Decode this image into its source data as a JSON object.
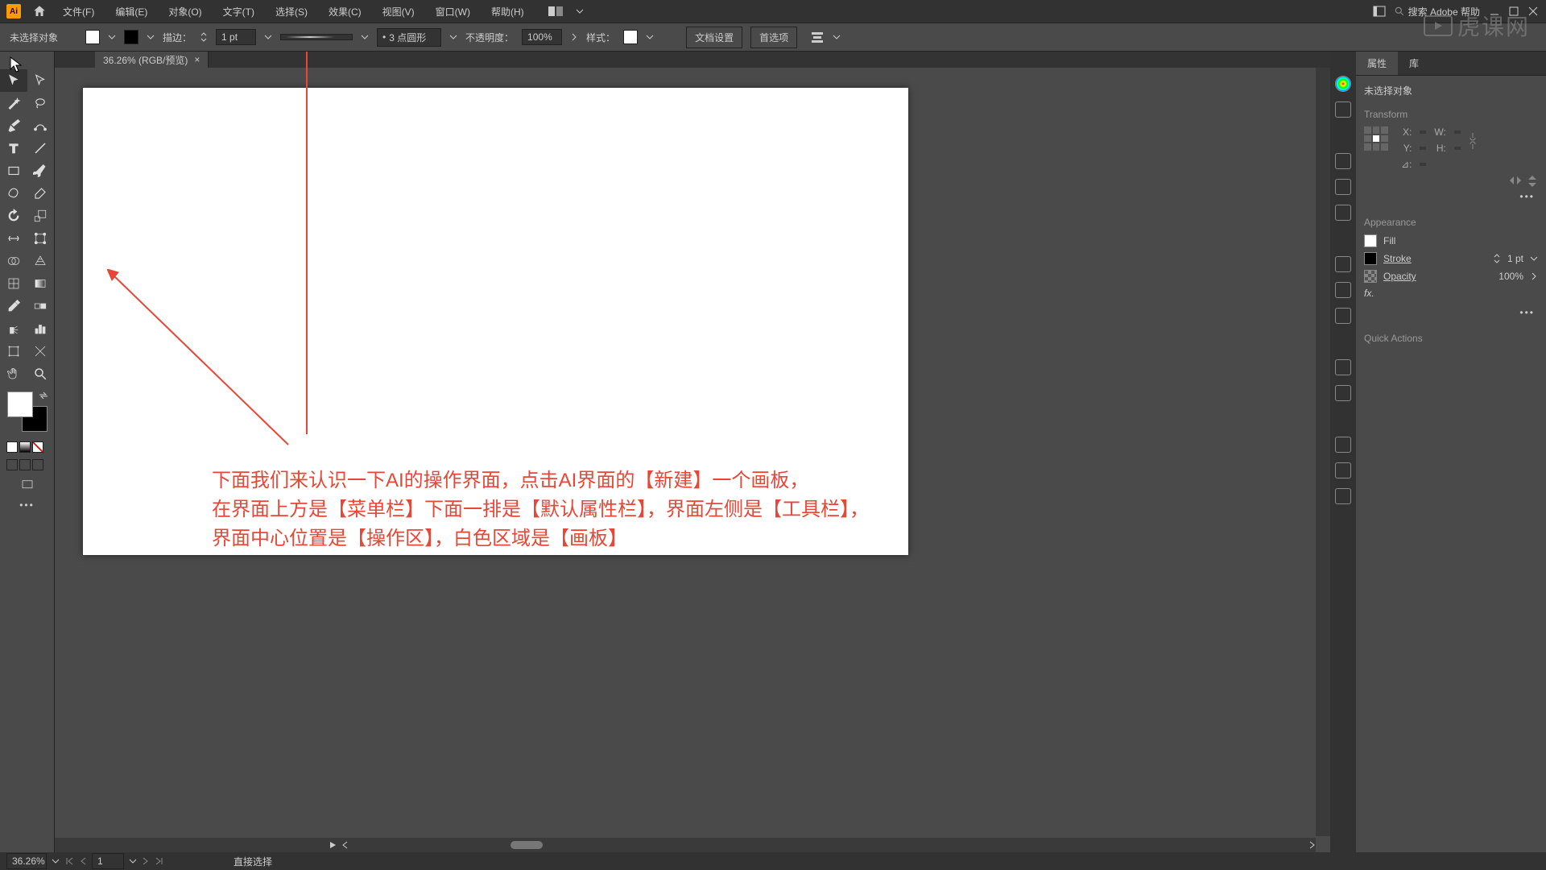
{
  "menubar": {
    "items": [
      "文件(F)",
      "编辑(E)",
      "对象(O)",
      "文字(T)",
      "选择(S)",
      "效果(C)",
      "视图(V)",
      "窗口(W)",
      "帮助(H)"
    ],
    "search_placeholder": "搜索 Adobe 帮助"
  },
  "controlbar": {
    "no_selection": "未选择对象",
    "stroke_label": "描边：",
    "stroke_value": "1 pt",
    "dash_label": "3 点圆形",
    "opacity_label": "不透明度：",
    "opacity_value": "100%",
    "style_label": "样式：",
    "doc_setup": "文档设置",
    "prefs": "首选项"
  },
  "tab": {
    "title": "36.26% (RGB/预览)"
  },
  "annotation": {
    "line1": "下面我们来认识一下AI的操作界面，点击AI界面的【新建】一个画板，",
    "line2": "在界面上方是【菜单栏】下面一排是【默认属性栏】，界面左侧是【工具栏】，",
    "line3": "界面中心位置是【操作区】，白色区域是【画板】"
  },
  "panels": {
    "tabs": [
      "属性",
      "库"
    ],
    "no_selection": "未选择对象",
    "transform": {
      "title": "Transform",
      "x_label": "X:",
      "x_val": "",
      "y_label": "Y:",
      "y_val": "",
      "w_label": "W:",
      "w_val": "",
      "h_label": "H:",
      "h_val": "",
      "angle_label": "⊿:"
    },
    "appearance": {
      "title": "Appearance",
      "fill": "Fill",
      "stroke": "Stroke",
      "stroke_val": "1 pt",
      "opacity": "Opacity",
      "opacity_val": "100%",
      "fx": "fx."
    },
    "quick_actions": "Quick Actions"
  },
  "statusbar": {
    "zoom": "36.26%",
    "artboard_num": "1",
    "tool_hint": "直接选择"
  },
  "watermark": "虎课网"
}
